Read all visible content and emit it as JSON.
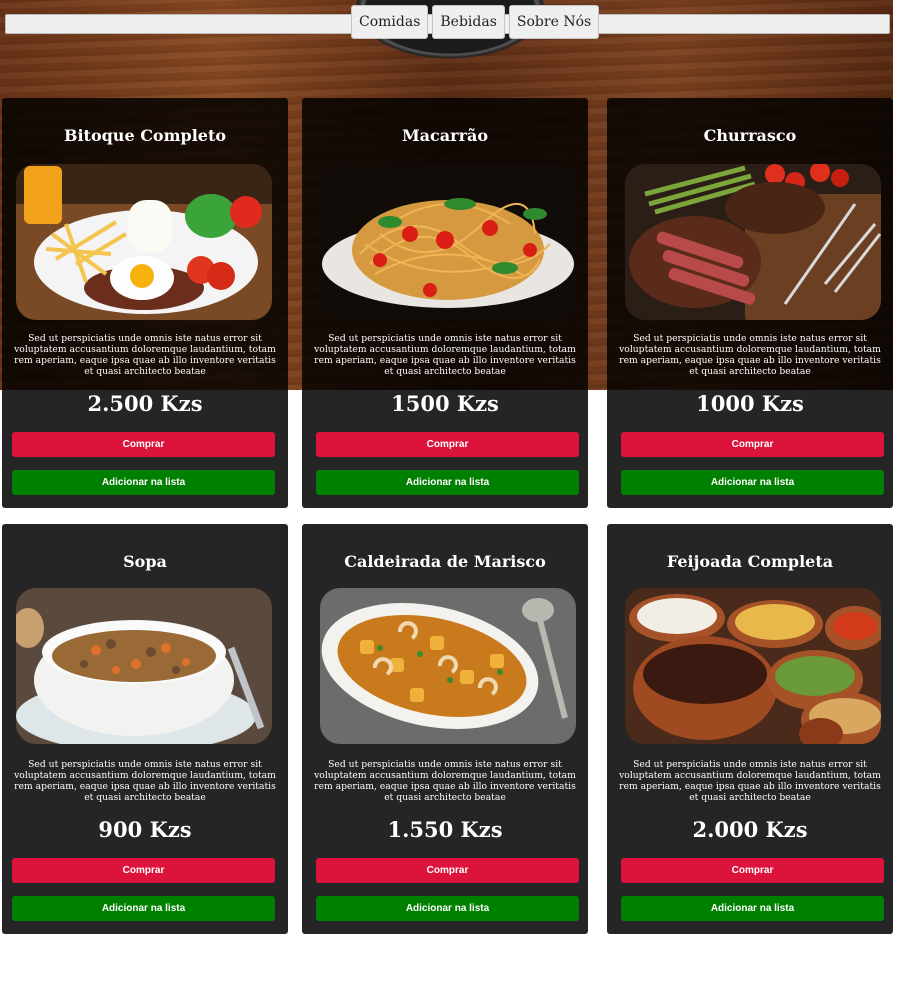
{
  "nav": {
    "items": [
      "Comidas",
      "Bebidas",
      "Sobre Nós"
    ]
  },
  "products": [
    {
      "title": "Bitoque Completo",
      "image": "steak-egg-fries-image",
      "description": "Sed ut perspiciatis unde omnis iste natus error sit voluptatem accusantium doloremque laudantium, totam rem aperiam, eaque ipsa quae ab illo inventore veritatis et quasi architecto beatae",
      "price": "2.500 Kzs",
      "buy_label": "Comprar",
      "list_label": "Adicionar na lista"
    },
    {
      "title": "Macarrão",
      "image": "spaghetti-image",
      "description": "Sed ut perspiciatis unde omnis iste natus error sit voluptatem accusantium doloremque laudantium, totam rem aperiam, eaque ipsa quae ab illo inventore veritatis et quasi architecto beatae",
      "price": "1500 Kzs",
      "buy_label": "Comprar",
      "list_label": "Adicionar na lista"
    },
    {
      "title": "Churrasco",
      "image": "grilled-steak-image",
      "description": "Sed ut perspiciatis unde omnis iste natus error sit voluptatem accusantium doloremque laudantium, totam rem aperiam, eaque ipsa quae ab illo inventore veritatis et quasi architecto beatae",
      "price": "1000 Kzs",
      "buy_label": "Comprar",
      "list_label": "Adicionar na lista"
    },
    {
      "title": "Sopa",
      "image": "soup-bowl-image",
      "description": "Sed ut perspiciatis unde omnis iste natus error sit voluptatem accusantium doloremque laudantium, totam rem aperiam, eaque ipsa quae ab illo inventore veritatis et quasi architecto beatae",
      "price": "900 Kzs",
      "buy_label": "Comprar",
      "list_label": "Adicionar na lista"
    },
    {
      "title": "Caldeirada de Marisco",
      "image": "seafood-stew-image",
      "description": "Sed ut perspiciatis unde omnis iste natus error sit voluptatem accusantium doloremque laudantium, totam rem aperiam, eaque ipsa quae ab illo inventore veritatis et quasi architecto beatae",
      "price": "1.550 Kzs",
      "buy_label": "Comprar",
      "list_label": "Adicionar na lista"
    },
    {
      "title": "Feijoada Completa",
      "image": "feijoada-image",
      "description": "Sed ut perspiciatis unde omnis iste natus error sit voluptatem accusantium doloremque laudantium, totam rem aperiam, eaque ipsa quae ab illo inventore veritatis et quasi architecto beatae",
      "price": "2.000 Kzs",
      "buy_label": "Comprar",
      "list_label": "Adicionar na lista"
    }
  ],
  "colors": {
    "buy": "#dc143c",
    "list": "#008000",
    "card": "#252525"
  }
}
